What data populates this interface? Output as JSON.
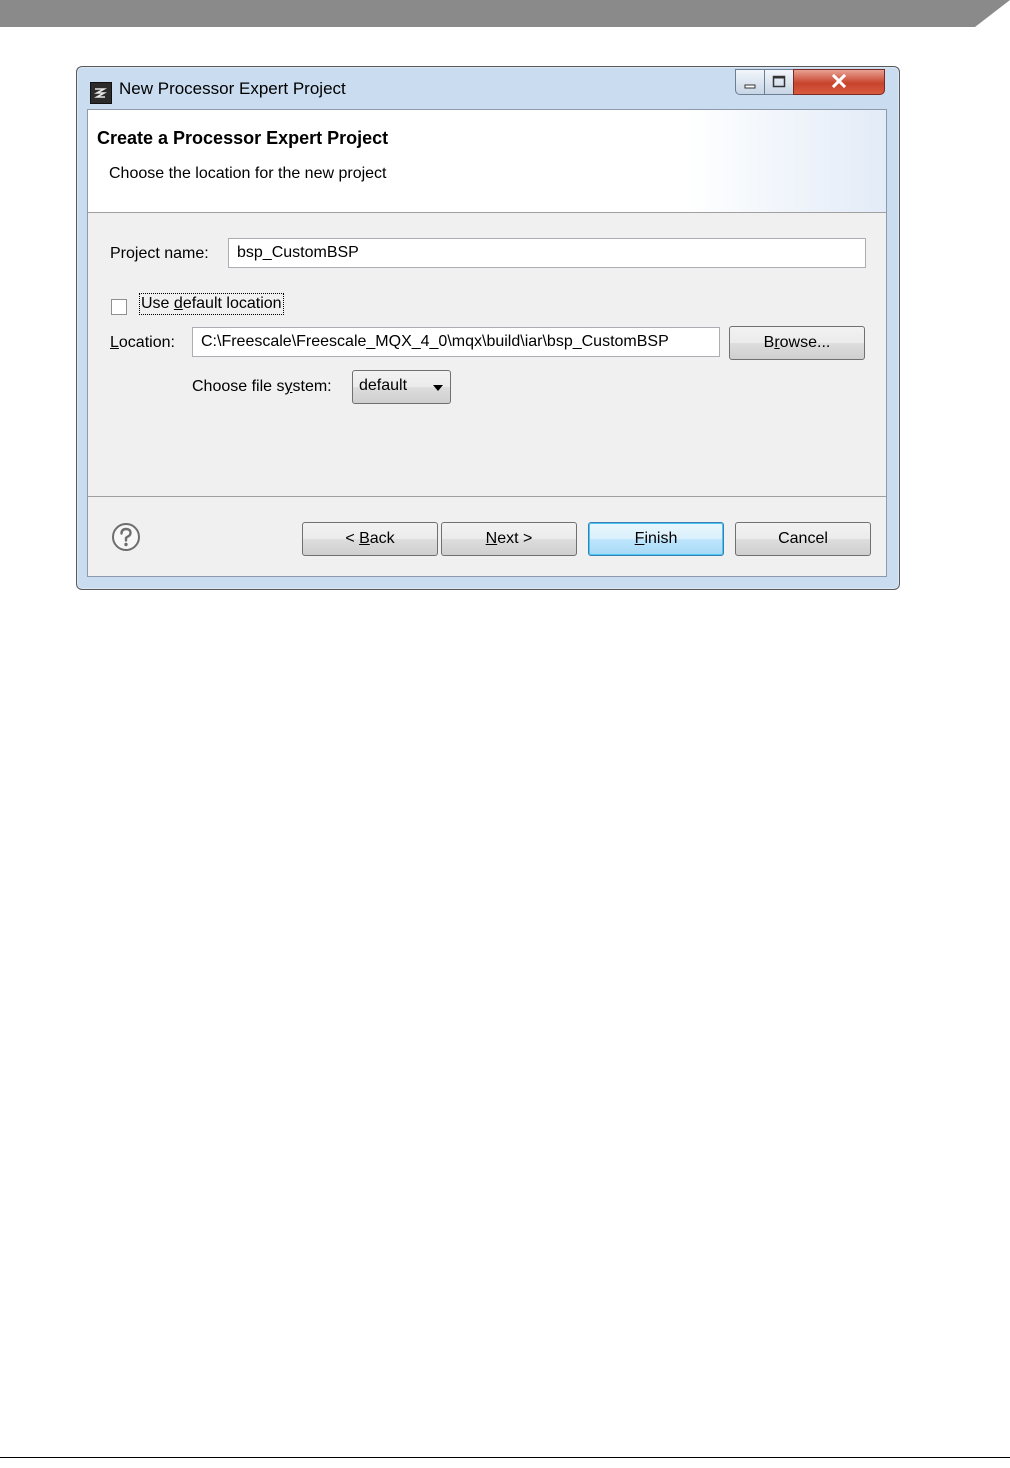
{
  "window": {
    "title": "New Processor Expert Project"
  },
  "banner": {
    "title": "Create a Processor Expert Project",
    "description": "Choose the location for the new project"
  },
  "form": {
    "project_name_label": "Project name:",
    "project_name_value": "bsp_CustomBSP",
    "use_default_location": {
      "label_prefix": "Use ",
      "label_mnemonic": "d",
      "label_suffix": "efault location",
      "checked": false
    },
    "location_label_mnemonic": "L",
    "location_label_rest": "ocation:",
    "location_value": "C:\\Freescale\\Freescale_MQX_4_0\\mqx\\build\\iar\\bsp_CustomBSP",
    "browse": {
      "prefix": "B",
      "mnemonic": "r",
      "suffix": "owse..."
    },
    "file_system_label_prefix": "Choose file s",
    "file_system_label_mnemonic": "y",
    "file_system_label_suffix": "stem:",
    "file_system_value": "default"
  },
  "buttons": {
    "back": {
      "prefix": "< ",
      "mnemonic": "B",
      "suffix": "ack"
    },
    "next": {
      "prefix": "",
      "mnemonic": "N",
      "suffix": "ext >"
    },
    "finish": {
      "prefix": "",
      "mnemonic": "F",
      "suffix": "inish"
    },
    "cancel": "Cancel"
  },
  "icons": {
    "app": "processor-expert-icon",
    "help": "question-circle-icon",
    "minimize": "minimize-icon",
    "maximize": "maximize-icon",
    "close": "close-icon"
  },
  "colors": {
    "page_bar": "#8a8a8a",
    "dialog_frame": "#c9dcf0",
    "close_button": "#c7432c",
    "default_button_border": "#3c7fb1"
  }
}
